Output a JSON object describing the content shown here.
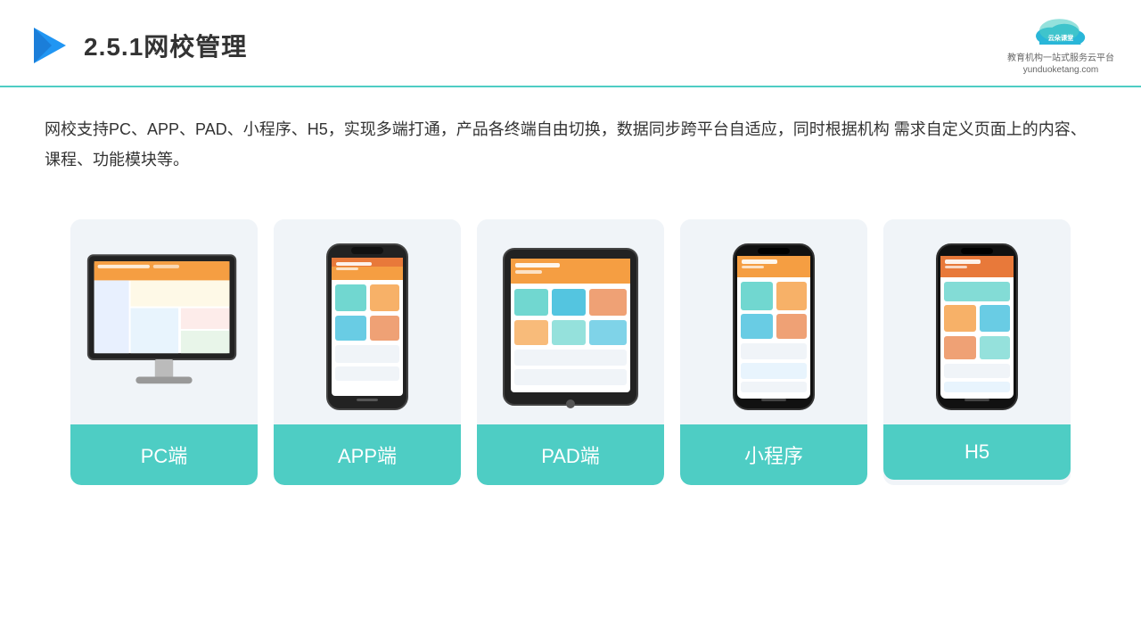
{
  "header": {
    "title": "2.5.1网校管理",
    "logo_name": "云朵课堂",
    "logo_sub": "yunduoketang.com",
    "logo_tagline": "教育机构一站\n式服务云平台"
  },
  "description": "网校支持PC、APP、PAD、小程序、H5，实现多端打通，产品各终端自由切换，数据同步跨平台自适应，同时根据机构\n需求自定义页面上的内容、课程、功能模块等。",
  "cards": [
    {
      "label": "PC端",
      "device": "pc"
    },
    {
      "label": "APP端",
      "device": "phone"
    },
    {
      "label": "PAD端",
      "device": "tablet"
    },
    {
      "label": "小程序",
      "device": "phone2"
    },
    {
      "label": "H5",
      "device": "phone3"
    }
  ],
  "accent_color": "#4ecdc4"
}
